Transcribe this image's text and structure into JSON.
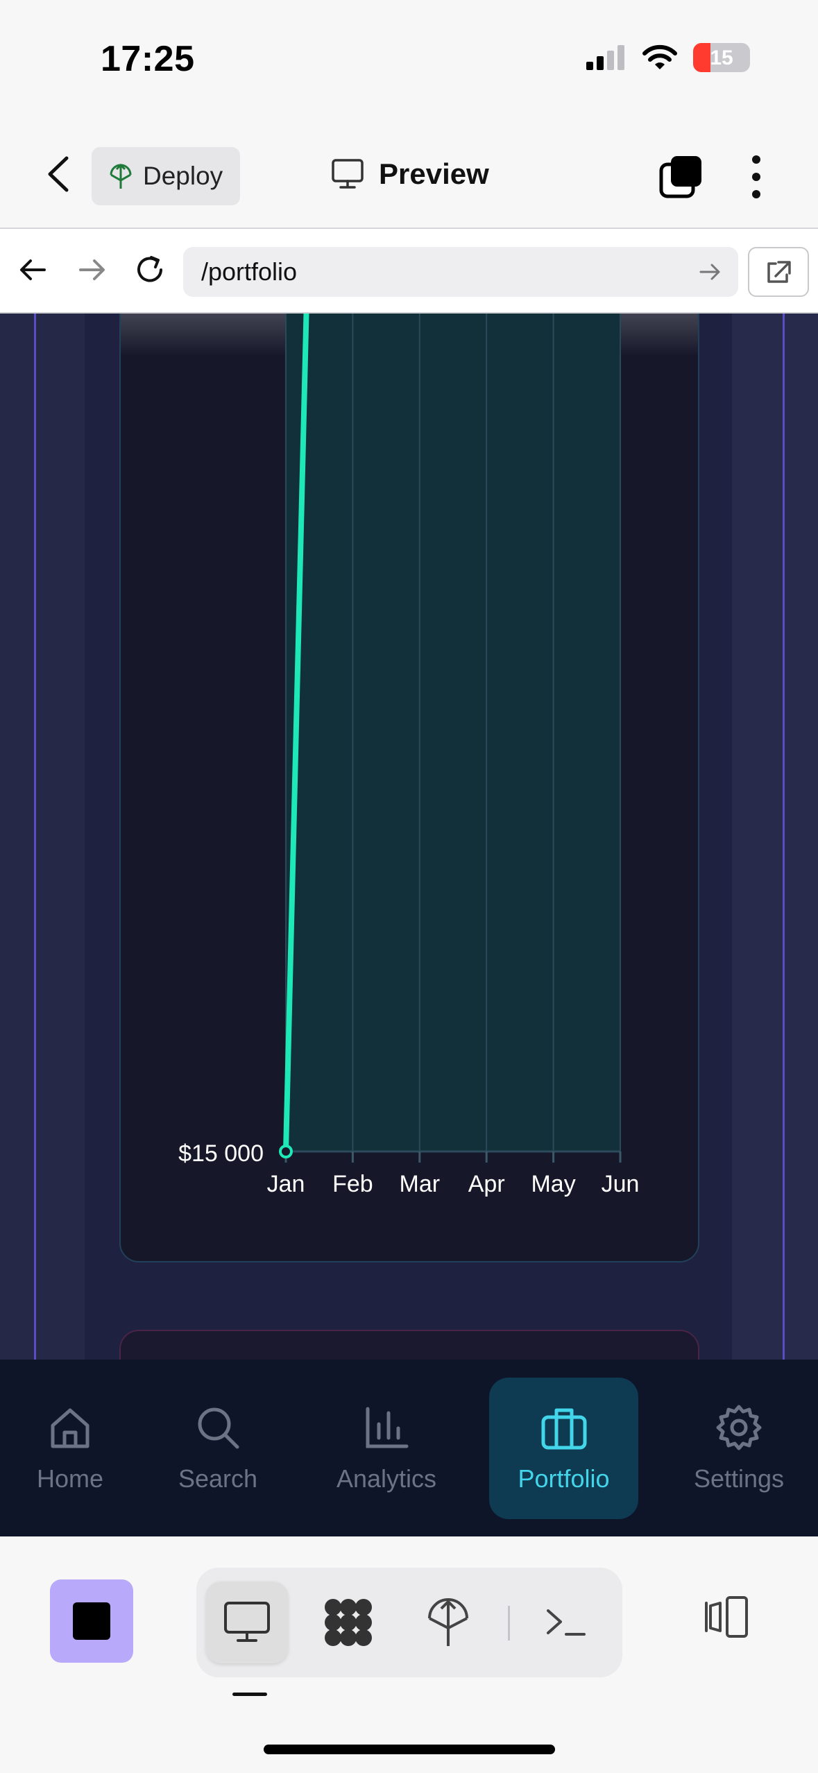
{
  "status_bar": {
    "time": "17:25",
    "battery_level": "15",
    "icons": [
      "signal-icon",
      "wifi-icon",
      "battery-icon"
    ]
  },
  "header": {
    "deploy_label": "Deploy",
    "preview_label": "Preview"
  },
  "browser": {
    "url": "/portfolio"
  },
  "tab_bar": {
    "items": [
      {
        "label": "Home",
        "icon": "home-icon"
      },
      {
        "label": "Search",
        "icon": "search-icon"
      },
      {
        "label": "Analytics",
        "icon": "analytics-icon"
      },
      {
        "label": "Portfolio",
        "icon": "briefcase-icon"
      },
      {
        "label": "Settings",
        "icon": "gear-icon"
      }
    ],
    "active": "Portfolio"
  },
  "colors": {
    "line": "#1ee8b5",
    "area": "#12303a",
    "active_tab": "#43d6ea",
    "accent": "#b9a9fb"
  },
  "chart_data": {
    "type": "area",
    "categories": [
      "Jan",
      "Feb",
      "Mar",
      "Apr",
      "May",
      "Jun"
    ],
    "y_tick_labels": [
      "$15 000"
    ],
    "series": [
      {
        "values": [
          15000,
          null,
          null,
          null,
          null,
          null
        ]
      }
    ],
    "grid": true,
    "legend": "none"
  }
}
